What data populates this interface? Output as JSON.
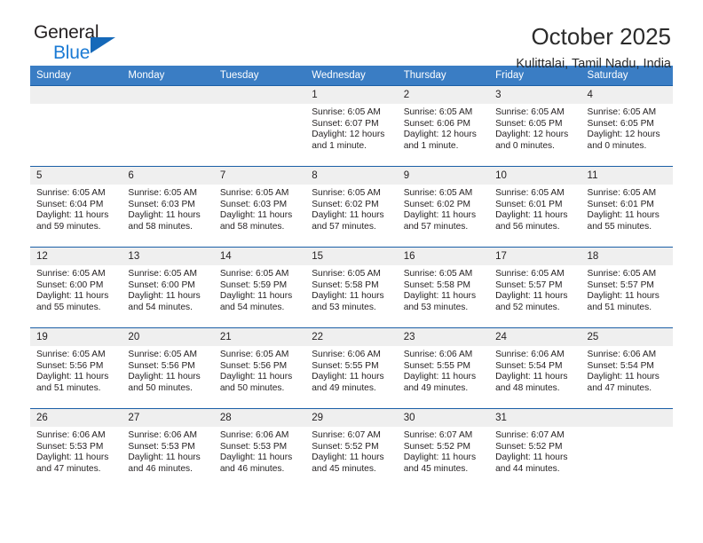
{
  "brand": {
    "name_top": "General",
    "name_bottom": "Blue",
    "triangle_color": "#1569b9",
    "blue_text_color": "#1a7ad4"
  },
  "header": {
    "title": "October 2025",
    "subtitle": "Kulittalai, Tamil Nadu, India"
  },
  "theme": {
    "header_row_color": "#3a7dc4",
    "day_number_band_color": "#efefef",
    "cell_border_color": "#1b5fa6"
  },
  "calendar": {
    "weekday_headers": [
      "Sunday",
      "Monday",
      "Tuesday",
      "Wednesday",
      "Thursday",
      "Friday",
      "Saturday"
    ],
    "weeks": [
      [
        {
          "day": "",
          "empty": true
        },
        {
          "day": "",
          "empty": true
        },
        {
          "day": "",
          "empty": true
        },
        {
          "day": "1",
          "sunrise": "Sunrise: 6:05 AM",
          "sunset": "Sunset: 6:07 PM",
          "daylight": "Daylight: 12 hours and 1 minute."
        },
        {
          "day": "2",
          "sunrise": "Sunrise: 6:05 AM",
          "sunset": "Sunset: 6:06 PM",
          "daylight": "Daylight: 12 hours and 1 minute."
        },
        {
          "day": "3",
          "sunrise": "Sunrise: 6:05 AM",
          "sunset": "Sunset: 6:05 PM",
          "daylight": "Daylight: 12 hours and 0 minutes."
        },
        {
          "day": "4",
          "sunrise": "Sunrise: 6:05 AM",
          "sunset": "Sunset: 6:05 PM",
          "daylight": "Daylight: 12 hours and 0 minutes."
        }
      ],
      [
        {
          "day": "5",
          "sunrise": "Sunrise: 6:05 AM",
          "sunset": "Sunset: 6:04 PM",
          "daylight": "Daylight: 11 hours and 59 minutes."
        },
        {
          "day": "6",
          "sunrise": "Sunrise: 6:05 AM",
          "sunset": "Sunset: 6:03 PM",
          "daylight": "Daylight: 11 hours and 58 minutes."
        },
        {
          "day": "7",
          "sunrise": "Sunrise: 6:05 AM",
          "sunset": "Sunset: 6:03 PM",
          "daylight": "Daylight: 11 hours and 58 minutes."
        },
        {
          "day": "8",
          "sunrise": "Sunrise: 6:05 AM",
          "sunset": "Sunset: 6:02 PM",
          "daylight": "Daylight: 11 hours and 57 minutes."
        },
        {
          "day": "9",
          "sunrise": "Sunrise: 6:05 AM",
          "sunset": "Sunset: 6:02 PM",
          "daylight": "Daylight: 11 hours and 57 minutes."
        },
        {
          "day": "10",
          "sunrise": "Sunrise: 6:05 AM",
          "sunset": "Sunset: 6:01 PM",
          "daylight": "Daylight: 11 hours and 56 minutes."
        },
        {
          "day": "11",
          "sunrise": "Sunrise: 6:05 AM",
          "sunset": "Sunset: 6:01 PM",
          "daylight": "Daylight: 11 hours and 55 minutes."
        }
      ],
      [
        {
          "day": "12",
          "sunrise": "Sunrise: 6:05 AM",
          "sunset": "Sunset: 6:00 PM",
          "daylight": "Daylight: 11 hours and 55 minutes."
        },
        {
          "day": "13",
          "sunrise": "Sunrise: 6:05 AM",
          "sunset": "Sunset: 6:00 PM",
          "daylight": "Daylight: 11 hours and 54 minutes."
        },
        {
          "day": "14",
          "sunrise": "Sunrise: 6:05 AM",
          "sunset": "Sunset: 5:59 PM",
          "daylight": "Daylight: 11 hours and 54 minutes."
        },
        {
          "day": "15",
          "sunrise": "Sunrise: 6:05 AM",
          "sunset": "Sunset: 5:58 PM",
          "daylight": "Daylight: 11 hours and 53 minutes."
        },
        {
          "day": "16",
          "sunrise": "Sunrise: 6:05 AM",
          "sunset": "Sunset: 5:58 PM",
          "daylight": "Daylight: 11 hours and 53 minutes."
        },
        {
          "day": "17",
          "sunrise": "Sunrise: 6:05 AM",
          "sunset": "Sunset: 5:57 PM",
          "daylight": "Daylight: 11 hours and 52 minutes."
        },
        {
          "day": "18",
          "sunrise": "Sunrise: 6:05 AM",
          "sunset": "Sunset: 5:57 PM",
          "daylight": "Daylight: 11 hours and 51 minutes."
        }
      ],
      [
        {
          "day": "19",
          "sunrise": "Sunrise: 6:05 AM",
          "sunset": "Sunset: 5:56 PM",
          "daylight": "Daylight: 11 hours and 51 minutes."
        },
        {
          "day": "20",
          "sunrise": "Sunrise: 6:05 AM",
          "sunset": "Sunset: 5:56 PM",
          "daylight": "Daylight: 11 hours and 50 minutes."
        },
        {
          "day": "21",
          "sunrise": "Sunrise: 6:05 AM",
          "sunset": "Sunset: 5:56 PM",
          "daylight": "Daylight: 11 hours and 50 minutes."
        },
        {
          "day": "22",
          "sunrise": "Sunrise: 6:06 AM",
          "sunset": "Sunset: 5:55 PM",
          "daylight": "Daylight: 11 hours and 49 minutes."
        },
        {
          "day": "23",
          "sunrise": "Sunrise: 6:06 AM",
          "sunset": "Sunset: 5:55 PM",
          "daylight": "Daylight: 11 hours and 49 minutes."
        },
        {
          "day": "24",
          "sunrise": "Sunrise: 6:06 AM",
          "sunset": "Sunset: 5:54 PM",
          "daylight": "Daylight: 11 hours and 48 minutes."
        },
        {
          "day": "25",
          "sunrise": "Sunrise: 6:06 AM",
          "sunset": "Sunset: 5:54 PM",
          "daylight": "Daylight: 11 hours and 47 minutes."
        }
      ],
      [
        {
          "day": "26",
          "sunrise": "Sunrise: 6:06 AM",
          "sunset": "Sunset: 5:53 PM",
          "daylight": "Daylight: 11 hours and 47 minutes."
        },
        {
          "day": "27",
          "sunrise": "Sunrise: 6:06 AM",
          "sunset": "Sunset: 5:53 PM",
          "daylight": "Daylight: 11 hours and 46 minutes."
        },
        {
          "day": "28",
          "sunrise": "Sunrise: 6:06 AM",
          "sunset": "Sunset: 5:53 PM",
          "daylight": "Daylight: 11 hours and 46 minutes."
        },
        {
          "day": "29",
          "sunrise": "Sunrise: 6:07 AM",
          "sunset": "Sunset: 5:52 PM",
          "daylight": "Daylight: 11 hours and 45 minutes."
        },
        {
          "day": "30",
          "sunrise": "Sunrise: 6:07 AM",
          "sunset": "Sunset: 5:52 PM",
          "daylight": "Daylight: 11 hours and 45 minutes."
        },
        {
          "day": "31",
          "sunrise": "Sunrise: 6:07 AM",
          "sunset": "Sunset: 5:52 PM",
          "daylight": "Daylight: 11 hours and 44 minutes."
        },
        {
          "day": "",
          "empty": true
        }
      ]
    ]
  }
}
